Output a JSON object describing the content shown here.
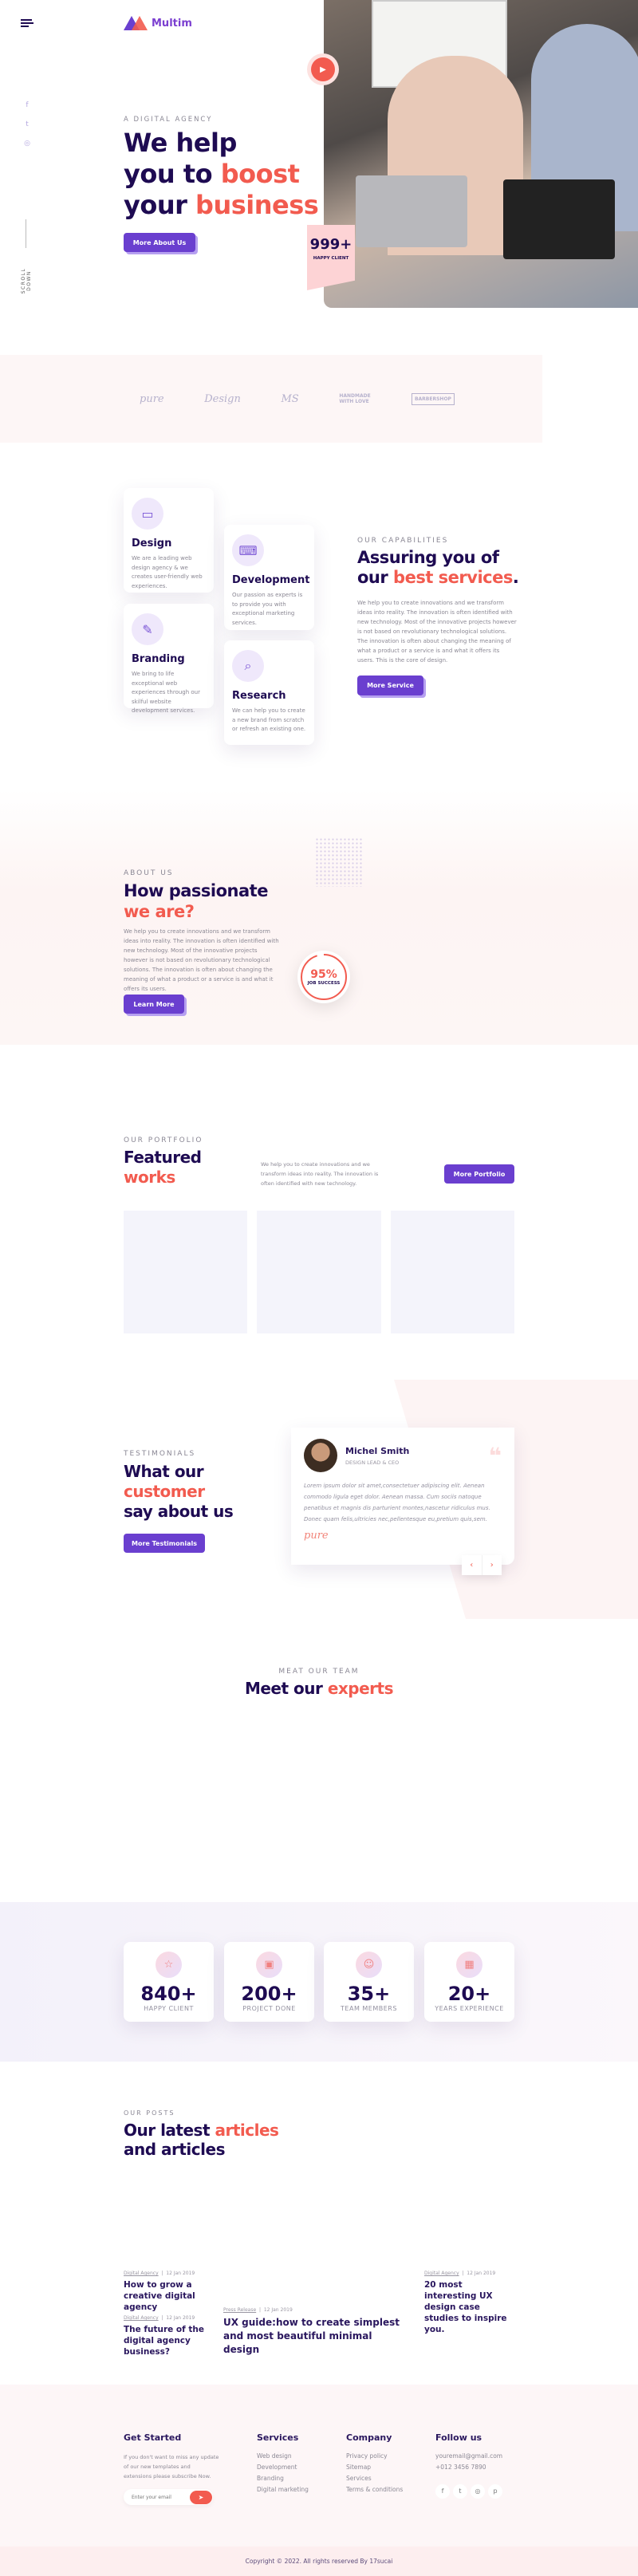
{
  "header": {
    "brand": "Multim",
    "menu_icon": "hamburger-icon"
  },
  "social_side": [
    "facebook-icon",
    "twitter-icon",
    "instagram-icon"
  ],
  "scroll_label": "SCROLL DOWN",
  "hero": {
    "tagline": "A DIGITAL AGENCY",
    "line1": "We help",
    "line2a": "you to ",
    "line2b": "boost",
    "line3a": "your ",
    "line3b": "business",
    "button": "More About Us",
    "counter": "999+",
    "counter_label": "HAPPY CLIENT"
  },
  "logos": [
    "pure",
    "Design",
    "MS",
    "HANDMADE WITH LOVE",
    "BARBERSHOP"
  ],
  "services": {
    "tagline": "OUR CAPABILITIES",
    "h1": "Assuring you of",
    "h2a": "our ",
    "h2b": "best services",
    "h2c": ".",
    "text": "We help you to create innovations and we transform ideas into reality. The innovation is often identified with new technology. Most of the innovative projects however is not based on revolutionary technological solutions. The innovation is often about changing the meaning of what a product or a service is and what it offers its users. This is the core of design.",
    "button": "More Service",
    "cards": [
      {
        "title": "Design",
        "desc": "We are a leading web design agency & we creates user-friendly web experiences."
      },
      {
        "title": "Development",
        "desc": "Our passion as experts is to provide you with exceptional marketing services."
      },
      {
        "title": "Branding",
        "desc": "We bring to life exceptional web experiences through our skilful website development services."
      },
      {
        "title": "Research",
        "desc": "We can help you to create a new brand from scratch or refresh an existing one."
      }
    ]
  },
  "about": {
    "tagline": "ABOUT US",
    "h1": "How passionate",
    "h2": "we are?",
    "text": "We help you to create innovations and we transform ideas into reality. The innovation is often identified with new technology. Most of the innovative projects however is not based on revolutionary technological solutions. The innovation is often about changing the meaning of what a product or a service is and what it offers its users.",
    "button": "Learn More",
    "percent": "95%",
    "percent_value": 95,
    "percent_label": "JOB SUCCESS"
  },
  "portfolio": {
    "tagline": "OUR PORTFOLIO",
    "h1": "Featured",
    "h2": "works",
    "text": "We help you to create innovations and we transform ideas into reality. The innovation is often identified with new technology.",
    "button": "More Portfolio"
  },
  "testimonials": {
    "tagline": "TESTIMONIALS",
    "h1": "What our",
    "h2": "customer",
    "h3": "say about us",
    "button": "More Testimonials",
    "name": "Michel Smith",
    "role": "DESIGN LEAD & CEO",
    "quote": "Lorem ipsum dolor sit amet,consectetuer adipiscing elit. Aenean commodo ligula eget dolor. Aenean massa. Cum sociis natoque penatibus et magnis dis parturient montes,nascetur ridiculus mus. Donec quam felis,ultricies nec,pellentesque eu,pretium quis,sem.",
    "logo": "pure",
    "prev": "‹",
    "next": "›"
  },
  "team": {
    "tagline": "MEAT OUR TEAM",
    "h1": "Meet our ",
    "h2": "experts"
  },
  "stats": [
    {
      "num": "840+",
      "label": "HAPPY CLIENT",
      "icon": "client-rating-icon"
    },
    {
      "num": "200+",
      "label": "PROJECT DONE",
      "icon": "project-icon"
    },
    {
      "num": "35+",
      "label": "TEAM MEMBERS",
      "icon": "team-icon"
    },
    {
      "num": "20+",
      "label": "YEARS EXPERIENCE",
      "icon": "calendar-icon"
    }
  ],
  "posts": {
    "tagline": "OUR POSTS",
    "h1a": "Our latest ",
    "h1b": "articles",
    "h2": "and articles",
    "items": [
      {
        "cat": "Digital Agency",
        "date": "12 Jan 2019",
        "title": "How to grow a creative digital agency"
      },
      {
        "cat": "Digital Agency",
        "date": "12 Jan 2019",
        "title": "The future of the digital agency business?"
      },
      {
        "cat": "Press Release",
        "date": "12 Jan 2019",
        "title": "UX guide:how to create simplest and most beautiful minimal design"
      },
      {
        "cat": "Digital Agency",
        "date": "12 Jan 2019",
        "title": "20 most interesting UX design case studies to inspire you."
      }
    ]
  },
  "footer": {
    "get_started": "Get Started",
    "gs_text": "If you don't want to miss any update of our new templates and extensions please subscribe Now.",
    "email_placeholder": "Enter your email",
    "services_title": "Services",
    "services": [
      "Web design",
      "Development",
      "Branding",
      "Digital marketing"
    ],
    "company_title": "Company",
    "company": [
      "Privacy policy",
      "Sitemap",
      "Services",
      "Terms & conditions"
    ],
    "follow_title": "Follow us",
    "email": "youremail@gmail.com",
    "phone": "+012 3456 7890",
    "copyright": "Copyright © 2022. All rights reserved By 17sucai"
  },
  "colors": {
    "primary": "#6a3fcf",
    "accent": "#f25b4f",
    "heading": "#1e0b52"
  }
}
